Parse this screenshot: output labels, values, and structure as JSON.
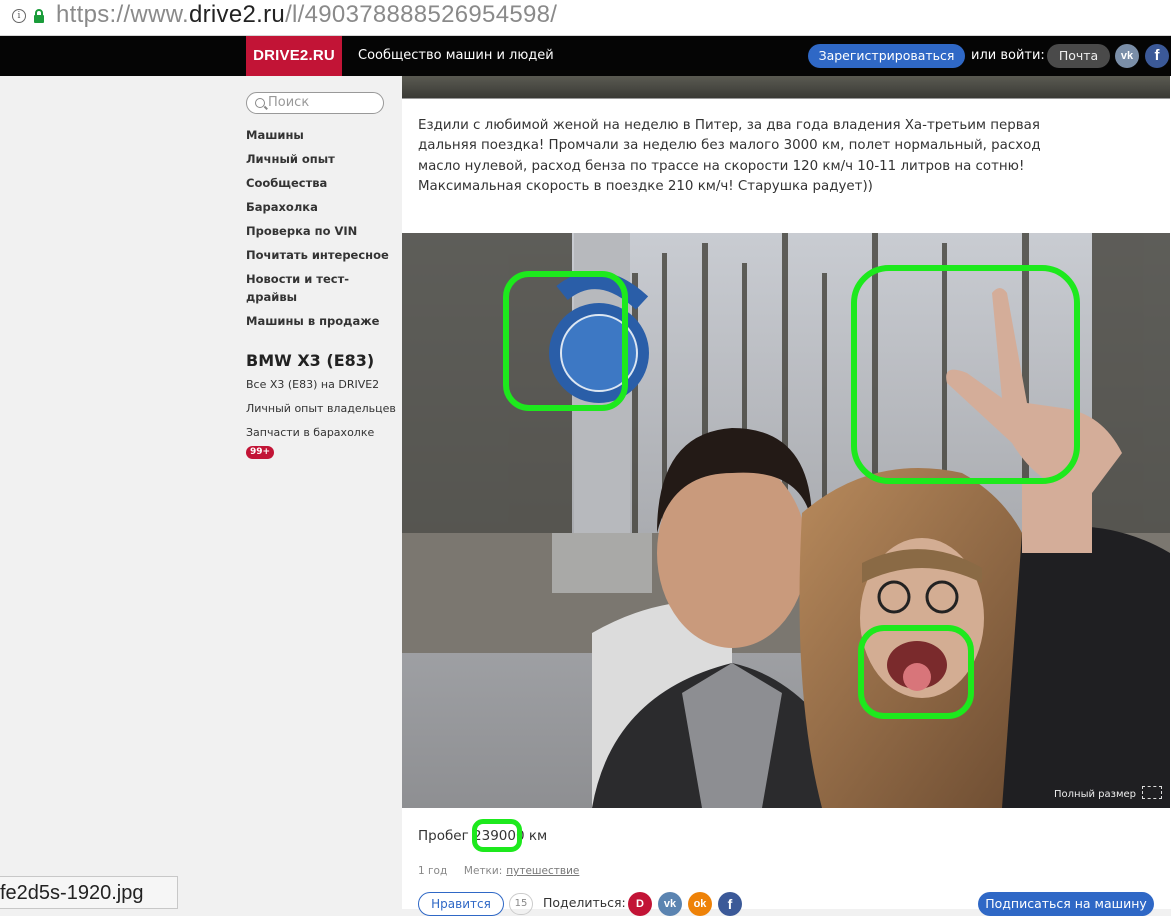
{
  "browser": {
    "url_prefix": "https://www.",
    "url_domain": "drive2.ru",
    "url_path": "/l/490378888526954598/"
  },
  "header": {
    "logo": "DRIVE2.RU",
    "tagline": "Сообщество машин и людей",
    "register_label": "Зарегистрироваться",
    "or_login": "или войти:",
    "mail_label": "Почта",
    "vk_icon": "vk-icon",
    "fb_icon": "facebook-icon"
  },
  "sidebar": {
    "search_placeholder": "Поиск",
    "nav": [
      "Машины",
      "Личный опыт",
      "Сообщества",
      "Барахолка",
      "Проверка по VIN",
      "Почитать интересное",
      "Новости и тест-драйвы",
      "Машины в продаже"
    ],
    "car_title": "BMW X3 (E83)",
    "car_links": [
      "Все X3 (E83) на DRIVE2",
      "Личный опыт владельцев",
      "Запчасти в барахолке"
    ],
    "parts_badge": "99+"
  },
  "post": {
    "text": "Ездили с любимой женой на неделю в Питер, за два года владения Ха-третьим первая дальняя поездка! Промчали за неделю без малого 3000 км, полет нормальный, расход масло нулевой, расход бенза по трассе на скорости 120 км/ч 10-11 литров на сотню! Максимальная скорость в поездке 210 км/ч! Старушка радует))",
    "fullsize_label": "Полный размер",
    "mileage_label": "Пробег",
    "mileage_value": "239000 км",
    "age": "1 год",
    "tags_label": "Метки:",
    "tag": "путешествие",
    "like_label": "Нравится",
    "like_count": "15",
    "share_label": "Поделиться:",
    "subscribe_label": "Подписаться на машину"
  },
  "download": {
    "filename": "fe2d5s-1920.jpg"
  },
  "colors": {
    "brand": "#c21436",
    "accent": "#2f68c6",
    "highlight": "#1de91d"
  }
}
